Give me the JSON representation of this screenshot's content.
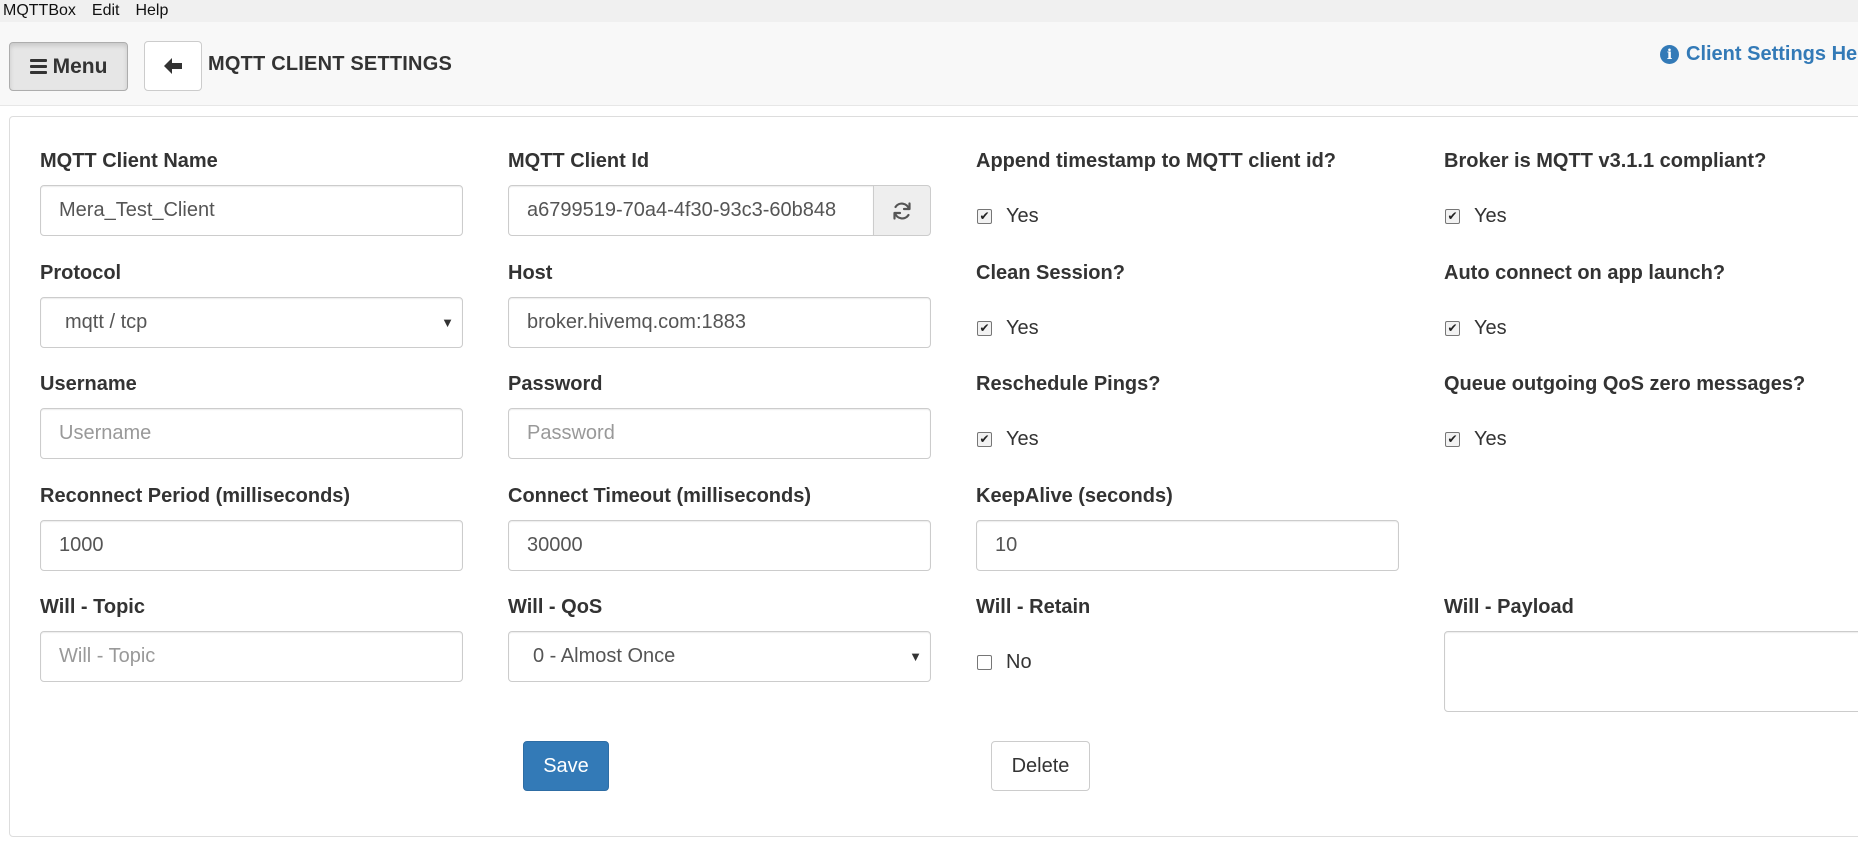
{
  "menubar": {
    "items": [
      "MQTTBox",
      "Edit",
      "Help"
    ]
  },
  "header": {
    "menu_label": "Menu",
    "title": "MQTT CLIENT SETTINGS",
    "help_label": "Client Settings He"
  },
  "form": {
    "client_name": {
      "label": "MQTT Client Name",
      "value": "Mera_Test_Client"
    },
    "client_id": {
      "label": "MQTT Client Id",
      "value": "a6799519-70a4-4f30-93c3-60b848"
    },
    "append_timestamp": {
      "label": "Append timestamp to MQTT client id?",
      "option": "Yes",
      "checked": true
    },
    "mqtt_311": {
      "label": "Broker is MQTT v3.1.1 compliant?",
      "option": "Yes",
      "checked": true
    },
    "protocol": {
      "label": "Protocol",
      "value": "mqtt / tcp"
    },
    "host": {
      "label": "Host",
      "value": "broker.hivemq.com:1883"
    },
    "clean_session": {
      "label": "Clean Session?",
      "option": "Yes",
      "checked": true
    },
    "auto_connect": {
      "label": "Auto connect on app launch?",
      "option": "Yes",
      "checked": true
    },
    "username": {
      "label": "Username",
      "placeholder": "Username",
      "value": ""
    },
    "password": {
      "label": "Password",
      "placeholder": "Password",
      "value": ""
    },
    "reschedule_pings": {
      "label": "Reschedule Pings?",
      "option": "Yes",
      "checked": true
    },
    "queue_qos_zero": {
      "label": "Queue outgoing QoS zero messages?",
      "option": "Yes",
      "checked": true
    },
    "reconnect_period": {
      "label": "Reconnect Period (milliseconds)",
      "value": "1000"
    },
    "connect_timeout": {
      "label": "Connect Timeout (milliseconds)",
      "value": "30000"
    },
    "keepalive": {
      "label": "KeepAlive (seconds)",
      "value": "10"
    },
    "will_topic": {
      "label": "Will - Topic",
      "placeholder": "Will - Topic",
      "value": ""
    },
    "will_qos": {
      "label": "Will - QoS",
      "value": "0 - Almost Once"
    },
    "will_retain": {
      "label": "Will - Retain",
      "option": "No",
      "checked": false
    },
    "will_payload": {
      "label": "Will - Payload",
      "value": ""
    }
  },
  "actions": {
    "save_label": "Save",
    "delete_label": "Delete"
  },
  "colors": {
    "primary": "#337ab7",
    "text": "#333333",
    "border": "#cccccc"
  }
}
